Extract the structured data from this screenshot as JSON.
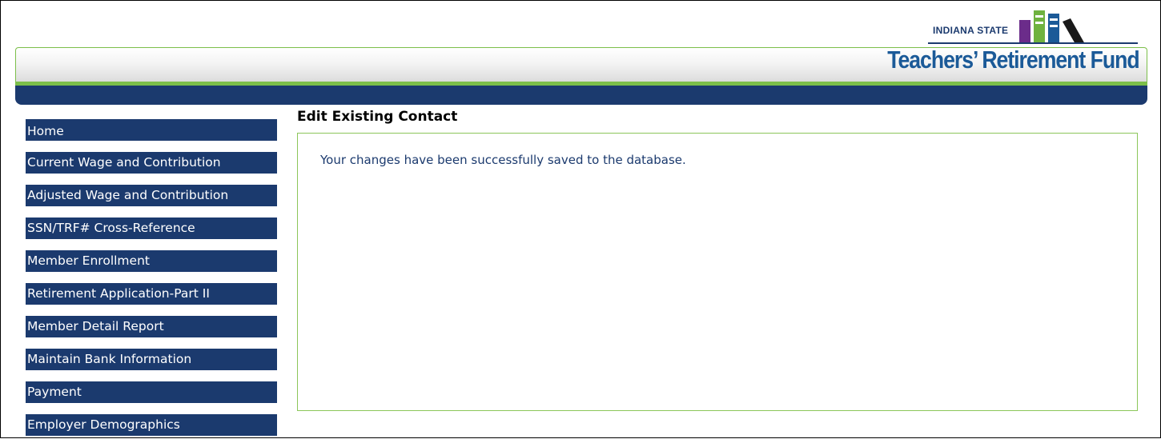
{
  "header": {
    "logo_state": "INDIANA STATE",
    "logo_name": "Teachers’ Retirement Fund",
    "colors": {
      "navy": "#1b3a6e",
      "green": "#7cbf4a",
      "logo_blue": "#1b5a98",
      "book_purple": "#6b2c8a",
      "book_green": "#6fb23f",
      "book_black": "#1a1a1a"
    }
  },
  "sidebar": {
    "items": [
      {
        "label": "Home"
      },
      {
        "label": "Current Wage and Contribution"
      },
      {
        "label": "Adjusted Wage and Contribution"
      },
      {
        "label": "SSN/TRF# Cross-Reference"
      },
      {
        "label": "Member Enrollment"
      },
      {
        "label": "Retirement Application-Part II"
      },
      {
        "label": "Member Detail Report"
      },
      {
        "label": "Maintain Bank Information"
      },
      {
        "label": "Payment"
      },
      {
        "label": "Employer Demographics"
      }
    ]
  },
  "main": {
    "title": "Edit Existing Contact",
    "message": "Your changes have been successfully saved to the database."
  }
}
